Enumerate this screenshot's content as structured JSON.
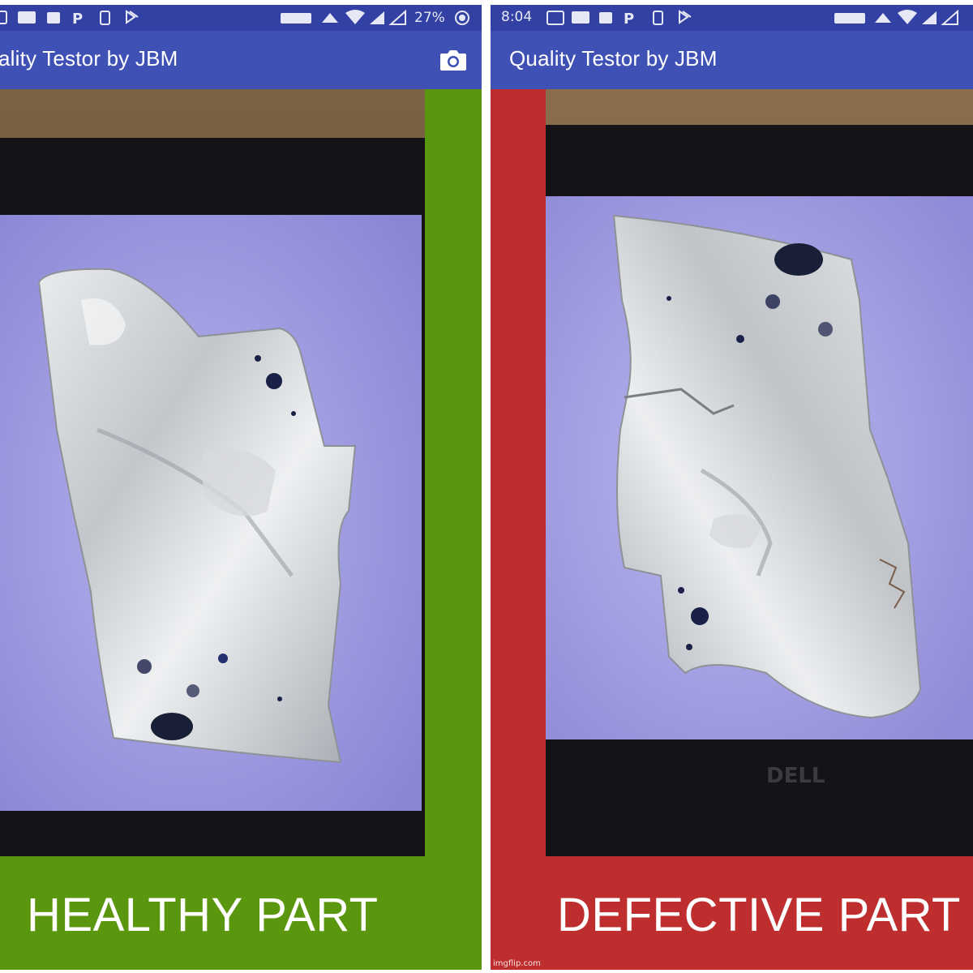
{
  "left": {
    "app_title": "ality Testor by JBM",
    "status_bar": {
      "battery_pct": "27%"
    },
    "result_label": "HEALTHY PART",
    "result_color": "#5b960f",
    "side_stripe_color": "#5b960f"
  },
  "right": {
    "app_title": "Quality Testor by JBM",
    "status_bar": {
      "time": "8:04"
    },
    "result_label": "DEFECTIVE PART",
    "result_color": "#be2e2e",
    "side_stripe_color": "#be2e2e",
    "laptop_brand": "DELL",
    "watermark": "imgflip.com"
  },
  "colors": {
    "status_bar": "#3241a3",
    "app_bar": "#3f51b5",
    "text": "#ffffff"
  },
  "icons": [
    "camera-icon",
    "wifi-icon",
    "signal-icon",
    "battery-icon",
    "notification-icons"
  ]
}
